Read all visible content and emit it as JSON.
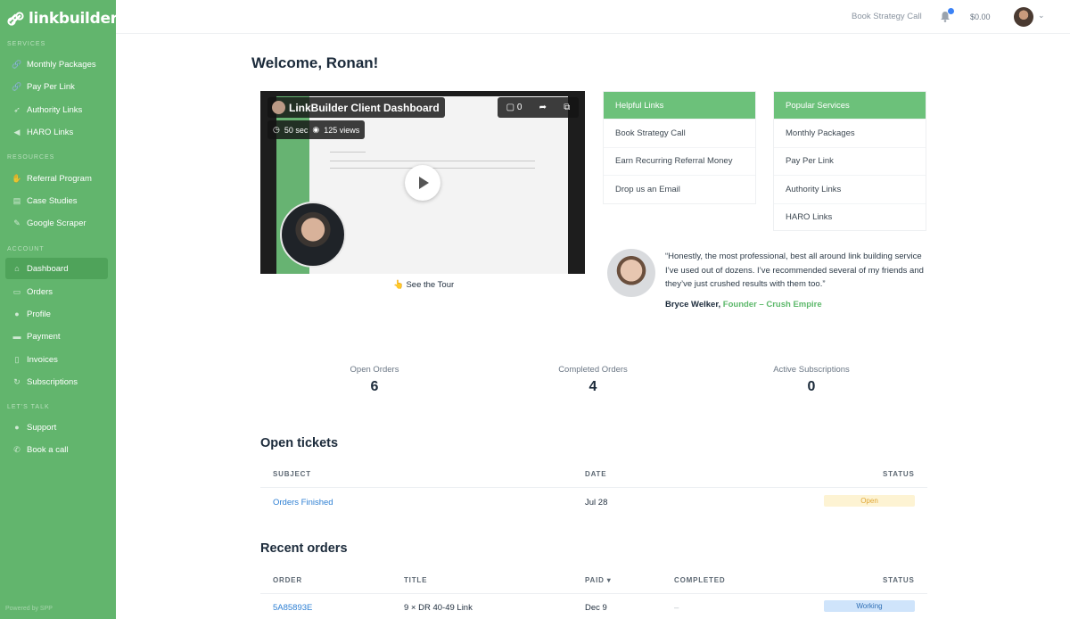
{
  "brand": {
    "name": "linkbuilder.io",
    "accent": "#62b56d",
    "panel_header": "#6cc17a"
  },
  "sidebar": {
    "sections": [
      {
        "label": "SERVICES",
        "items": [
          {
            "label": "Monthly Packages",
            "icon": "link-icon"
          },
          {
            "label": "Pay Per Link",
            "icon": "link-icon"
          },
          {
            "label": "Authority Links",
            "icon": "rocket-icon"
          },
          {
            "label": "HARO Links",
            "icon": "megaphone-icon"
          }
        ]
      },
      {
        "label": "RESOURCES",
        "items": [
          {
            "label": "Referral Program",
            "icon": "handshake-icon"
          },
          {
            "label": "Case Studies",
            "icon": "chart-icon"
          },
          {
            "label": "Google Scraper",
            "icon": "wrench-icon"
          }
        ]
      },
      {
        "label": "ACCOUNT",
        "items": [
          {
            "label": "Dashboard",
            "icon": "home-icon",
            "active": true
          },
          {
            "label": "Orders",
            "icon": "inbox-icon"
          },
          {
            "label": "Profile",
            "icon": "user-icon"
          },
          {
            "label": "Payment",
            "icon": "card-icon"
          },
          {
            "label": "Invoices",
            "icon": "document-icon"
          },
          {
            "label": "Subscriptions",
            "icon": "refresh-icon"
          }
        ]
      },
      {
        "label": "LET'S TALK",
        "items": [
          {
            "label": "Support",
            "icon": "chat-icon"
          },
          {
            "label": "Book a call",
            "icon": "phone-icon"
          }
        ]
      }
    ],
    "powered_by": "Powered by SPP"
  },
  "topbar": {
    "strategy_link": "Book Strategy Call",
    "balance": "$0.00"
  },
  "main": {
    "welcome": "Welcome, Ronan!",
    "video": {
      "title": "LinkBuilder Client Dashboard",
      "duration": "50 sec",
      "views": "125 views",
      "comments": "0",
      "tour_link": "👆 See the Tour"
    },
    "helpful_links": {
      "title": "Helpful Links",
      "items": [
        "Book Strategy Call",
        "Earn Recurring Referral Money",
        "Drop us an Email"
      ]
    },
    "popular_services": {
      "title": "Popular Services",
      "items": [
        "Monthly Packages",
        "Pay Per Link",
        "Authority Links",
        "HARO Links"
      ]
    },
    "testimonial": {
      "quote": "“Honestly, the most professional, best all around link building service I’ve used out of dozens. I’ve recommended several of my friends and they’ve just crushed results with them too.”",
      "author": "Bryce Welker,",
      "role": "Founder – Crush Empire"
    },
    "stats": [
      {
        "label": "Open Orders",
        "value": "6"
      },
      {
        "label": "Completed Orders",
        "value": "4"
      },
      {
        "label": "Active Subscriptions",
        "value": "0"
      }
    ],
    "open_tickets": {
      "title": "Open tickets",
      "columns": [
        "SUBJECT",
        "DATE",
        "STATUS"
      ],
      "rows": [
        {
          "subject": "Orders Finished",
          "date": "Jul 28",
          "status": "Open"
        }
      ]
    },
    "recent_orders": {
      "title": "Recent orders",
      "columns": [
        "ORDER",
        "TITLE",
        "PAID",
        "COMPLETED",
        "STATUS"
      ],
      "sort_indicator": "▾",
      "rows": [
        {
          "order": "5A85893E",
          "title": "9 × DR 40-49 Link",
          "paid": "Dec 9",
          "completed": "–",
          "status": "Working"
        }
      ]
    }
  }
}
